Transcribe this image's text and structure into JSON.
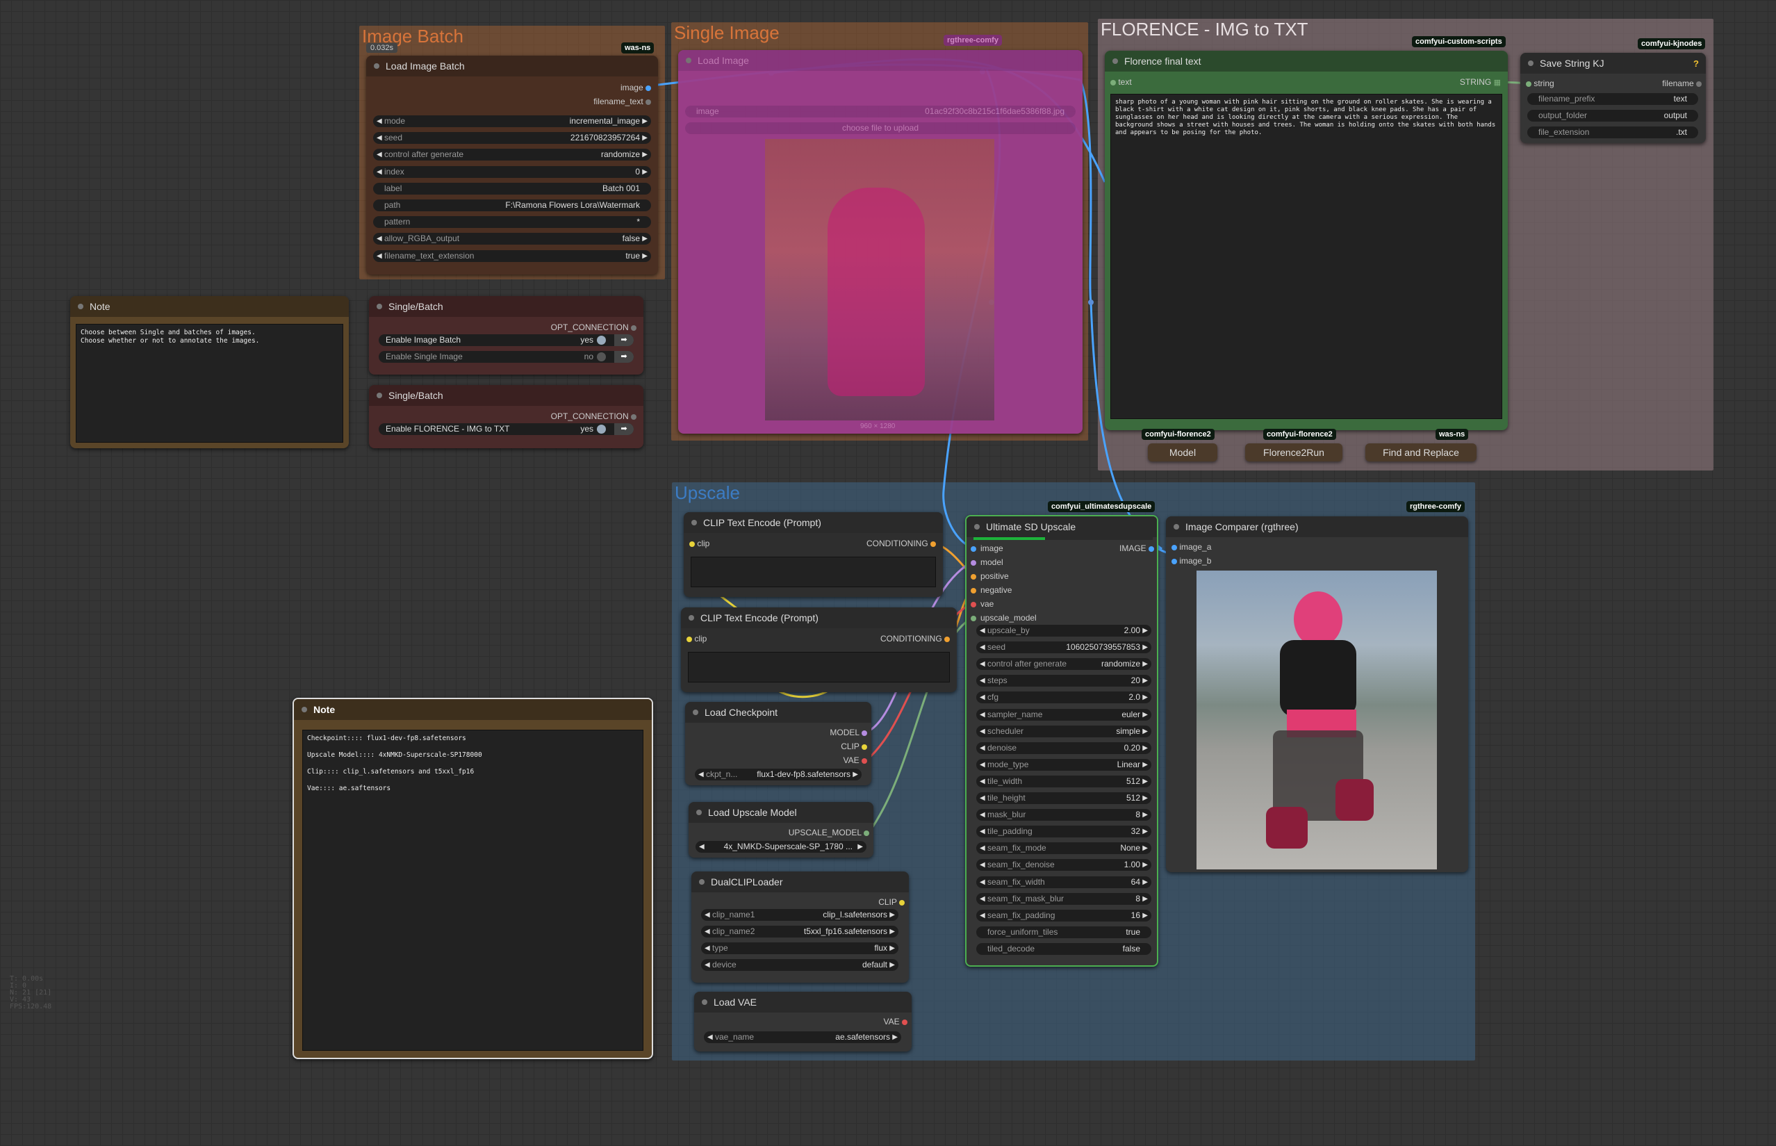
{
  "groups": {
    "image_batch": {
      "title": "Image Batch",
      "color": "#b06634"
    },
    "single_image": {
      "title": "Single Image",
      "color": "#b06634"
    },
    "florence": {
      "title": "FLORENCE - IMG to TXT",
      "color": "#a1858c"
    },
    "upscale": {
      "title": "Upscale",
      "color": "#3f6a8d"
    }
  },
  "zoom_label": "0.032s",
  "load_image_batch": {
    "title": "Load Image Batch",
    "badge": "was-ns",
    "outputs": [
      "image",
      "filename_text"
    ],
    "widgets": [
      {
        "label": "mode",
        "value": "incremental_image"
      },
      {
        "label": "seed",
        "value": "221670823957264"
      },
      {
        "label": "control after generate",
        "value": "randomize"
      },
      {
        "label": "index",
        "value": "0"
      },
      {
        "label": "label",
        "value": "Batch 001"
      },
      {
        "label": "path",
        "value": "F:\\Ramona Flowers Lora\\Watermark"
      },
      {
        "label": "pattern",
        "value": "*"
      },
      {
        "label": "allow_RGBA_output",
        "value": "false"
      },
      {
        "label": "filename_text_extension",
        "value": "true"
      }
    ]
  },
  "load_image_single": {
    "title": "Load Image",
    "badge": "rgthree-comfy",
    "image_widget": "image",
    "image_value": "01ac92f30c8b215c1f6dae5386f88.jpg",
    "upload_label": "choose file to upload",
    "size_label": "960 × 1280"
  },
  "note_left": {
    "title": "Note",
    "text": "Choose between Single and batches of images.\nChoose whether or not to annotate the images."
  },
  "single_batch_1": {
    "title": "Single/Batch",
    "output": "OPT_CONNECTION",
    "toggles": [
      {
        "label": "Enable Image Batch",
        "value": "yes"
      },
      {
        "label": "Enable Single Image",
        "value": "no"
      }
    ]
  },
  "single_batch_2": {
    "title": "Single/Batch",
    "output": "OPT_CONNECTION",
    "toggles": [
      {
        "label": "Enable FLORENCE - IMG to TXT",
        "value": "yes"
      }
    ]
  },
  "florence_text": {
    "title": "Florence final text",
    "badge": "comfyui-custom-scripts",
    "input": "text",
    "output": "STRING",
    "text": "sharp photo of a young woman with pink hair sitting on the ground on roller skates. She is wearing a black t-shirt with a white cat design on it, pink shorts, and black knee pads. She has a pair of sunglasses on her head and is looking directly at the camera with a serious expression. The background shows a street with houses and trees. The woman is holding onto the skates with both hands and appears to be posing for the photo."
  },
  "save_string": {
    "title": "Save String KJ",
    "badge": "comfyui-kjnodes",
    "help": "?",
    "input": "string",
    "output": "filename",
    "widgets": [
      {
        "label": "filename_prefix",
        "value": "text"
      },
      {
        "label": "output_folder",
        "value": "output"
      },
      {
        "label": "file_extension",
        "value": ".txt"
      }
    ]
  },
  "collapsed": {
    "model": {
      "label": "Model",
      "badge": "comfyui-florence2"
    },
    "run": {
      "label": "Florence2Run",
      "badge": "comfyui-florence2"
    },
    "replace": {
      "label": "Find and Replace",
      "badge": "was-ns"
    }
  },
  "clip_text_1": {
    "title": "CLIP Text Encode (Prompt)",
    "input": "clip",
    "output": "CONDITIONING"
  },
  "clip_text_2": {
    "title": "CLIP Text Encode (Prompt)",
    "input": "clip",
    "output": "CONDITIONING"
  },
  "load_checkpoint": {
    "title": "Load Checkpoint",
    "outputs": [
      "MODEL",
      "CLIP",
      "VAE"
    ],
    "widget": {
      "label": "ckpt_n...",
      "value": "flux1-dev-fp8.safetensors"
    }
  },
  "load_upscale": {
    "title": "Load Upscale Model",
    "output": "UPSCALE_MODEL",
    "widget": {
      "value": "4x_NMKD-Superscale-SP_1780 ..."
    }
  },
  "dual_clip": {
    "title": "DualCLIPLoader",
    "output": "CLIP",
    "widgets": [
      {
        "label": "clip_name1",
        "value": "clip_l.safetensors"
      },
      {
        "label": "clip_name2",
        "value": "t5xxl_fp16.safetensors"
      },
      {
        "label": "type",
        "value": "flux"
      },
      {
        "label": "device",
        "value": "default"
      }
    ]
  },
  "load_vae": {
    "title": "Load VAE",
    "output": "VAE",
    "widget": {
      "label": "vae_name",
      "value": "ae.safetensors"
    }
  },
  "ultimate_upscale": {
    "title": "Ultimate SD Upscale",
    "badge": "comfyui_ultimatesdupscale",
    "inputs": [
      "image",
      "model",
      "positive",
      "negative",
      "vae",
      "upscale_model"
    ],
    "output": "IMAGE",
    "progress": 0.4,
    "widgets": [
      {
        "label": "upscale_by",
        "value": "2.00"
      },
      {
        "label": "seed",
        "value": "1060250739557853"
      },
      {
        "label": "control after generate",
        "value": "randomize"
      },
      {
        "label": "steps",
        "value": "20"
      },
      {
        "label": "cfg",
        "value": "2.0"
      },
      {
        "label": "sampler_name",
        "value": "euler"
      },
      {
        "label": "scheduler",
        "value": "simple"
      },
      {
        "label": "denoise",
        "value": "0.20"
      },
      {
        "label": "mode_type",
        "value": "Linear"
      },
      {
        "label": "tile_width",
        "value": "512"
      },
      {
        "label": "tile_height",
        "value": "512"
      },
      {
        "label": "mask_blur",
        "value": "8"
      },
      {
        "label": "tile_padding",
        "value": "32"
      },
      {
        "label": "seam_fix_mode",
        "value": "None"
      },
      {
        "label": "seam_fix_denoise",
        "value": "1.00"
      },
      {
        "label": "seam_fix_width",
        "value": "64"
      },
      {
        "label": "seam_fix_mask_blur",
        "value": "8"
      },
      {
        "label": "seam_fix_padding",
        "value": "16"
      },
      {
        "label": "force_uniform_tiles",
        "value": "true"
      },
      {
        "label": "tiled_decode",
        "value": "false"
      }
    ]
  },
  "image_comparer": {
    "title": "Image Comparer (rgthree)",
    "badge": "rgthree-comfy",
    "inputs": [
      "image_a",
      "image_b"
    ]
  },
  "note_bottom": {
    "title": "Note",
    "text": "Checkpoint:::: flux1-dev-fp8.safetensors\n\nUpscale Model:::: 4xNMKD-Superscale-SP178000\n\nClip:::: clip_l.safetensors and t5xxl_fp16\n\nVae:::: ae.saftensors"
  },
  "stats": [
    "T: 0.00s",
    "I: 0",
    "N: 21 [21]",
    "V: 43",
    "FPS:120.48"
  ],
  "colors": {
    "link_blue": "#4aa3ff",
    "link_yellow": "#e8d33a",
    "link_orange": "#f0a030",
    "link_red": "#e05050",
    "link_purple": "#b58ce0",
    "link_green": "#7cae7a",
    "selected_outline": "#4caf50"
  }
}
